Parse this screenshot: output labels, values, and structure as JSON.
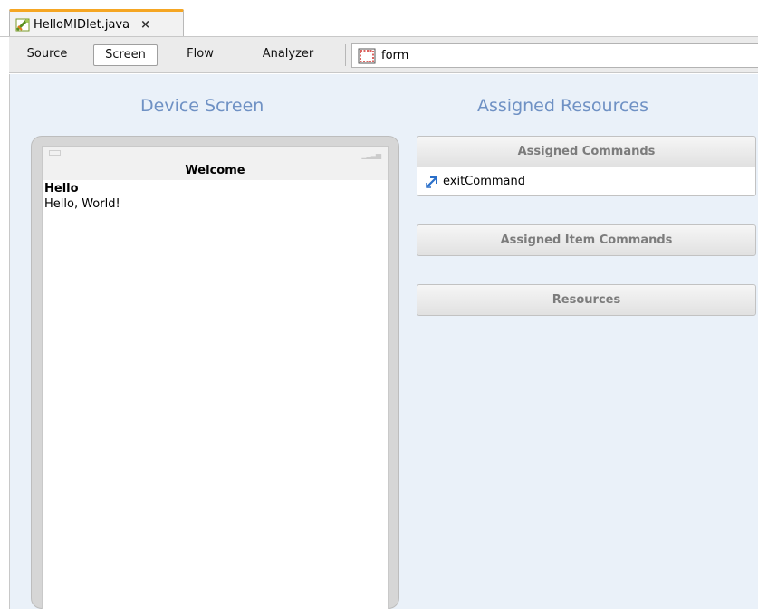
{
  "tab": {
    "file_name": "HelloMIDlet.java",
    "close_glyph": "×",
    "icon": "java-source-icon"
  },
  "toolbar": {
    "views": [
      "Source",
      "Screen",
      "Flow",
      "Analyzer"
    ],
    "active_view": "Screen",
    "form_label": "form",
    "form_icon": "form-icon"
  },
  "device": {
    "heading": "Device Screen",
    "screen_title": "Welcome",
    "item_label": "Hello",
    "item_text": "Hello, World!"
  },
  "resources": {
    "heading": "Assigned Resources",
    "sections": [
      {
        "label": "Assigned Commands",
        "items": [
          {
            "label": "exitCommand",
            "icon": "exit-command-icon"
          }
        ]
      },
      {
        "label": "Assigned Item Commands",
        "items": []
      },
      {
        "label": "Resources",
        "items": []
      }
    ]
  },
  "colors": {
    "tab_accent": "#f5a623",
    "design_background": "#eaf1f9",
    "heading": "#6f91c4"
  }
}
